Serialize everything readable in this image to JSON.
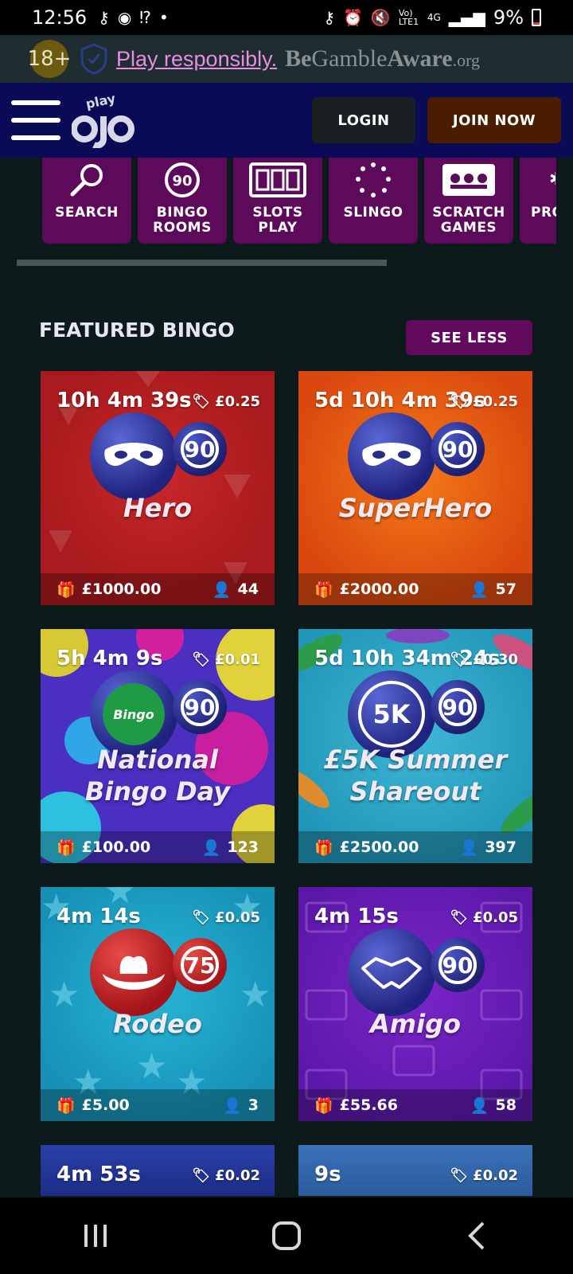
{
  "status": {
    "time": "12:56",
    "battery": "9%",
    "network": "4G",
    "lte": "Vo) LTE1"
  },
  "responsible": {
    "age": "18+",
    "link_text": "Play responsibly.",
    "brand_be": "Be",
    "brand_gamble": "Gamble",
    "brand_aware": "Aware",
    "brand_org": ".org"
  },
  "header": {
    "logo_play": "play",
    "logo_ojo": "ojo",
    "login": "LOGIN",
    "join": "JOIN NOW"
  },
  "categories": [
    {
      "label": "SEARCH",
      "icon": "search-icon"
    },
    {
      "label": "BINGO\nROOMS",
      "icon": "bingo-ball-icon",
      "icon_text": "90"
    },
    {
      "label": "SLOTS\nPLAY",
      "icon": "slots-icon"
    },
    {
      "label": "SLINGO",
      "icon": "slingo-icon"
    },
    {
      "label": "SCRATCH\nGAMES",
      "icon": "scratch-icon"
    },
    {
      "label": "PRO",
      "icon": "promo-icon"
    }
  ],
  "featured": {
    "title": "FEATURED BINGO",
    "see_less": "SEE LESS"
  },
  "games": [
    {
      "name": "Hero",
      "timer": "10h 4m 39s",
      "price": "£0.25",
      "jackpot": "£1000.00",
      "players": "44",
      "ball": "90",
      "theme": "#b61c1f"
    },
    {
      "name": "SuperHero",
      "timer": "5d 10h 4m 39s",
      "price": "£0.25",
      "jackpot": "£2000.00",
      "players": "57",
      "ball": "90",
      "theme": "#e05312"
    },
    {
      "name": "National Bingo Day",
      "name1": "National",
      "name2": "Bingo Day",
      "timer": "5h 4m 9s",
      "price": "£0.01",
      "jackpot": "£100.00",
      "players": "123",
      "ball": "90",
      "theme": "#4a2fc0",
      "ball_text": "Bingo"
    },
    {
      "name": "£5K Summer Shareout",
      "name1": "£5K Summer",
      "name2": "Shareout",
      "timer": "5d 10h 34m 24s",
      "price": "£0.30",
      "jackpot": "£2500.00",
      "players": "397",
      "ball": "90",
      "theme": "#2fa3c4",
      "ball_text": "5K"
    },
    {
      "name": "Rodeo",
      "timer": "4m 14s",
      "price": "£0.05",
      "jackpot": "£5.00",
      "players": "3",
      "ball": "75",
      "theme": "#1fa2c6"
    },
    {
      "name": "Amigo",
      "timer": "4m 15s",
      "price": "£0.05",
      "jackpot": "£55.66",
      "players": "58",
      "ball": "90",
      "theme": "#6a1fb8"
    },
    {
      "name": "",
      "timer": "4m 53s",
      "price": "£0.02",
      "jackpot": "",
      "players": "",
      "ball": "",
      "theme": "#263a9a"
    },
    {
      "name": "",
      "timer": "9s",
      "price": "£0.02",
      "jackpot": "",
      "players": "",
      "ball": "",
      "theme": "#3a6fb5"
    }
  ]
}
